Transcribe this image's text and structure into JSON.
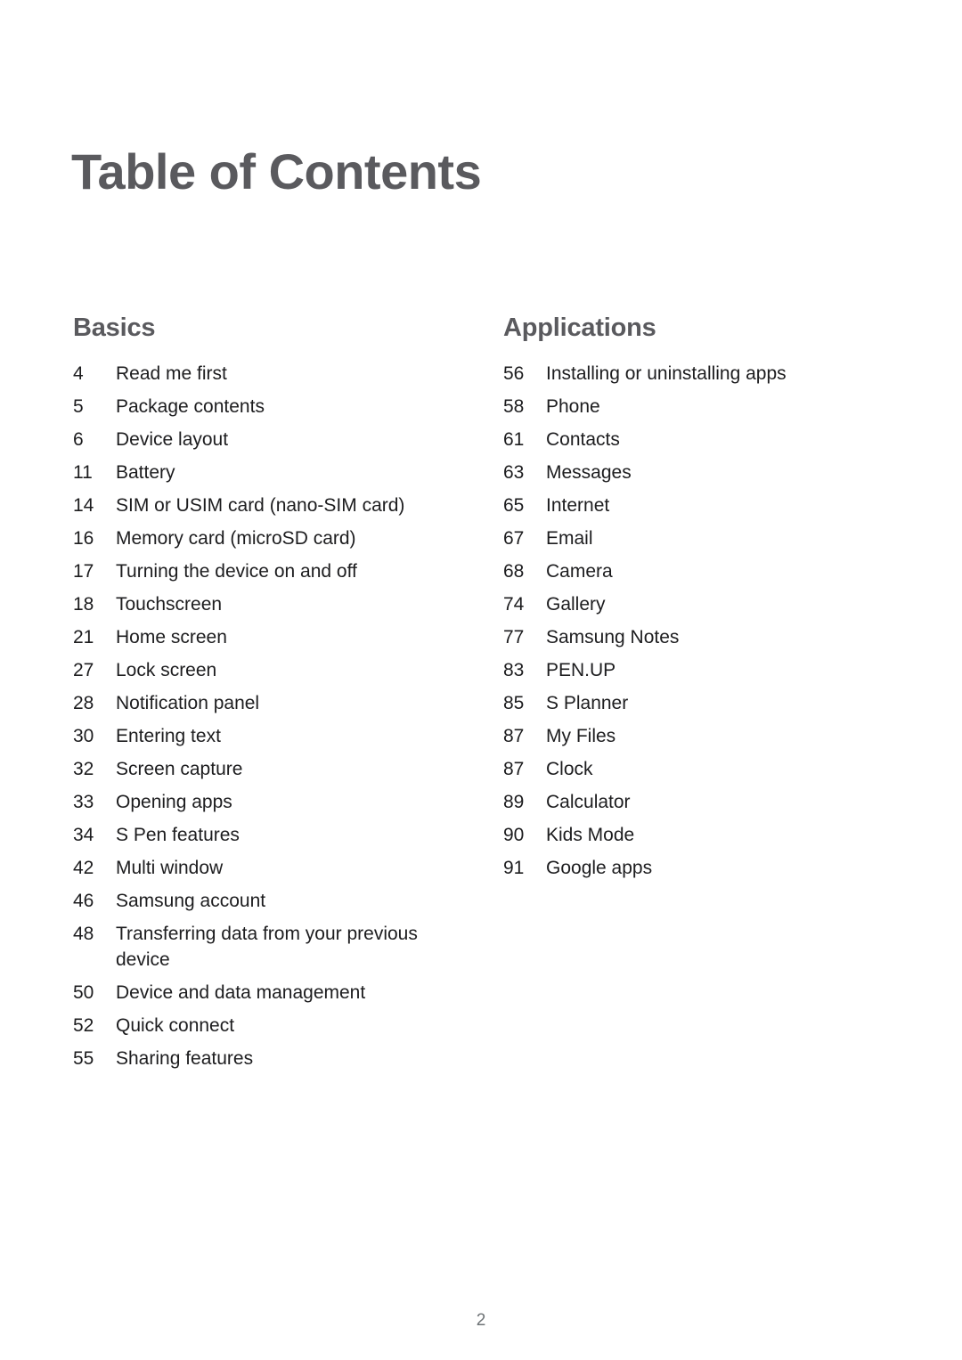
{
  "document": {
    "title": "Table of Contents",
    "page_number": "2"
  },
  "colors": {
    "heading": "#5a5a5e",
    "body_text": "#1d1d1f",
    "page_number": "#6d7275",
    "background": "#ffffff"
  },
  "columns": [
    {
      "heading": "Basics",
      "entries": [
        {
          "page": "4",
          "title": "Read me first"
        },
        {
          "page": "5",
          "title": "Package contents"
        },
        {
          "page": "6",
          "title": "Device layout"
        },
        {
          "page": "11",
          "title": "Battery"
        },
        {
          "page": "14",
          "title": "SIM or USIM card (nano-SIM card)"
        },
        {
          "page": "16",
          "title": "Memory card (microSD card)"
        },
        {
          "page": "17",
          "title": "Turning the device on and off"
        },
        {
          "page": "18",
          "title": "Touchscreen"
        },
        {
          "page": "21",
          "title": "Home screen"
        },
        {
          "page": "27",
          "title": "Lock screen"
        },
        {
          "page": "28",
          "title": "Notification panel"
        },
        {
          "page": "30",
          "title": "Entering text"
        },
        {
          "page": "32",
          "title": "Screen capture"
        },
        {
          "page": "33",
          "title": "Opening apps"
        },
        {
          "page": "34",
          "title": "S Pen features"
        },
        {
          "page": "42",
          "title": "Multi window"
        },
        {
          "page": "46",
          "title": "Samsung account"
        },
        {
          "page": "48",
          "title": "Transferring data from your previous device"
        },
        {
          "page": "50",
          "title": "Device and data management"
        },
        {
          "page": "52",
          "title": "Quick connect"
        },
        {
          "page": "55",
          "title": "Sharing features"
        }
      ]
    },
    {
      "heading": "Applications",
      "entries": [
        {
          "page": "56",
          "title": "Installing or uninstalling apps"
        },
        {
          "page": "58",
          "title": "Phone"
        },
        {
          "page": "61",
          "title": "Contacts"
        },
        {
          "page": "63",
          "title": "Messages"
        },
        {
          "page": "65",
          "title": "Internet"
        },
        {
          "page": "67",
          "title": "Email"
        },
        {
          "page": "68",
          "title": "Camera"
        },
        {
          "page": "74",
          "title": "Gallery"
        },
        {
          "page": "77",
          "title": "Samsung Notes"
        },
        {
          "page": "83",
          "title": "PEN.UP"
        },
        {
          "page": "85",
          "title": "S Planner"
        },
        {
          "page": "87",
          "title": "My Files"
        },
        {
          "page": "87",
          "title": "Clock"
        },
        {
          "page": "89",
          "title": "Calculator"
        },
        {
          "page": "90",
          "title": "Kids Mode"
        },
        {
          "page": "91",
          "title": "Google apps"
        }
      ]
    }
  ]
}
